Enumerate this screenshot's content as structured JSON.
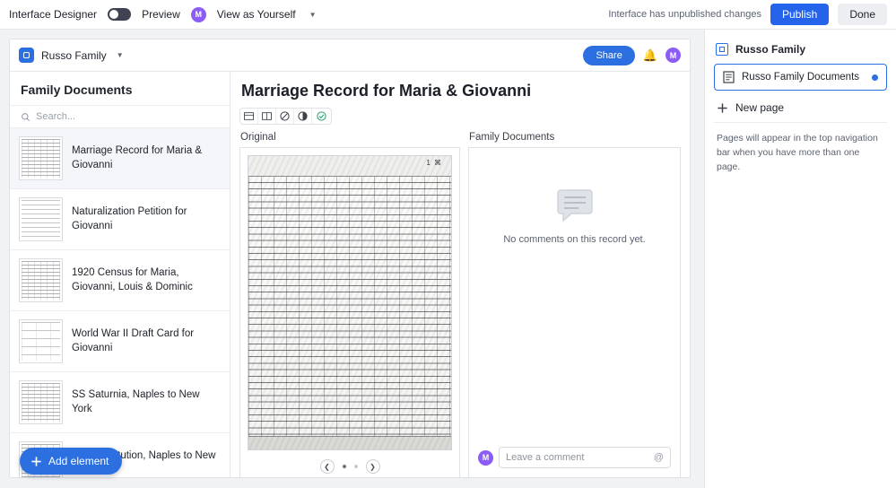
{
  "topbar": {
    "brand": "Interface Designer",
    "preview_label": "Preview",
    "avatar_initial": "M",
    "view_as": "View as Yourself",
    "unpublished_notice": "Interface has unpublished changes",
    "publish_label": "Publish",
    "done_label": "Done",
    "accent": "#2563eb"
  },
  "site_header": {
    "title": "Russo Family",
    "share_label": "Share",
    "avatar_initial": "M"
  },
  "left_panel": {
    "title": "Family Documents",
    "search_placeholder": "Search...",
    "items": [
      {
        "label": "Marriage Record for Maria & Giovanni",
        "thumb": "grid"
      },
      {
        "label": "Naturalization Petition for Giovanni",
        "thumb": "doc"
      },
      {
        "label": "1920 Census for Maria, Giovanni, Louis & Dominic",
        "thumb": "grid"
      },
      {
        "label": "World War II Draft Card for Giovanni",
        "thumb": "card"
      },
      {
        "label": "SS Saturnia, Naples to New York",
        "thumb": "grid"
      },
      {
        "label": "SS Constitution, Naples to New York",
        "thumb": "grid"
      }
    ],
    "selected_index": 0
  },
  "content": {
    "doc_title": "Marriage Record for Maria & Giovanni",
    "toolbar_icons": [
      "table-icon",
      "columns-icon",
      "no-entry-icon",
      "circle-half-icon",
      "circle-check-icon"
    ],
    "original_pane": {
      "heading": "Original",
      "scan_stamp": "1 ⌘",
      "page_dots": 2,
      "active_dot": 0
    },
    "comments_pane": {
      "heading": "Family Documents",
      "empty_text": "No comments on this record yet.",
      "compose_placeholder": "Leave a comment",
      "compose_avatar_initial": "M",
      "mention_icon": "@"
    }
  },
  "right_sidebar": {
    "page_title": "Russo Family",
    "card_label": "Russo Family Documents",
    "new_page_label": "New page",
    "note": "Pages will appear in the top navigation bar when you have more than one page.",
    "accent": "#2b6fe0"
  },
  "fab": {
    "label": "Add element",
    "icon": "plus-icon"
  }
}
